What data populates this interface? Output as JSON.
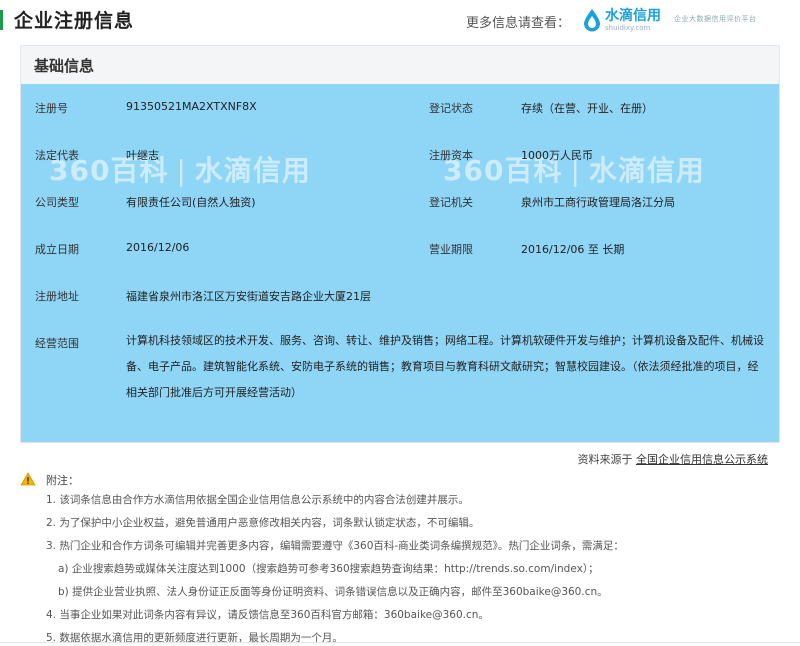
{
  "header": {
    "title": "企业注册信息",
    "more_label": "更多信息请查看：",
    "brand_name": "水滴信用",
    "brand_url": "shuidixy.com",
    "slogan": "企业大数据信用评价平台"
  },
  "card": {
    "title": "基础信息",
    "watermark": {
      "left": "360百科",
      "right": "水滴信用"
    },
    "fields": {
      "reg_no": {
        "label": "注册号",
        "value": "91350521MA2XTXNF8X"
      },
      "reg_status": {
        "label": "登记状态",
        "value": "存续（在营、开业、在册）"
      },
      "legal_rep": {
        "label": "法定代表",
        "value": "叶继志"
      },
      "capital": {
        "label": "注册资本",
        "value": "1000万人民币"
      },
      "company_type": {
        "label": "公司类型",
        "value": "有限责任公司(自然人独资)"
      },
      "authority": {
        "label": "登记机关",
        "value": "泉州市工商行政管理局洛江分局"
      },
      "founded": {
        "label": "成立日期",
        "value": "2016/12/06"
      },
      "term": {
        "label": "营业期限",
        "value": "2016/12/06 至 长期"
      },
      "address": {
        "label": "注册地址",
        "value": "福建省泉州市洛江区万安街道安吉路企业大厦21层"
      },
      "scope": {
        "label": "经营范围",
        "value": "计算机科技领域区的技术开发、服务、咨询、转让、维护及销售；网络工程。计算机软硬件开发与维护；计算机设备及配件、机械设备、电子产品。建筑智能化系统、安防电子系统的销售；教育项目与教育科研文献研究；智慧校园建设。（依法须经批准的项目，经相关部门批准后方可开展经营活动）"
      }
    }
  },
  "source": {
    "prefix": "资料来源于",
    "link": "全国企业信用信息公示系统"
  },
  "notes": {
    "title": "附注：",
    "items": [
      "1. 该词条信息由合作方水滴信用依据全国企业信用信息公示系统中的内容合法创建并展示。",
      "2. 为了保护中小企业权益，避免普通用户恶意修改相关内容，词条默认锁定状态，不可编辑。",
      "3. 热门企业和合作方词条可编辑并完善更多内容，编辑需要遵守《360百科-商业类词条编撰规范》。热门企业词条，需满足：",
      "a) 企业搜索趋势或媒体关注度达到1000（搜索趋势可参考360搜索趋势查询结果：http://trends.so.com/index）；",
      "b) 提供企业营业执照、法人身份证正反面等身份证明资料、词条错误信息以及正确内容，邮件至360baike@360.cn。",
      "4. 当事企业如果对此词条内容有异议，请反馈信息至360百科官方邮箱：360baike@360.cn。",
      "5. 数据依据水滴信用的更新频度进行更新，最长周期为一个月。"
    ]
  },
  "colors": {
    "accent": "#1a9c4a",
    "card_bg": "#8fd5f5",
    "brand": "#1aa1e0"
  }
}
